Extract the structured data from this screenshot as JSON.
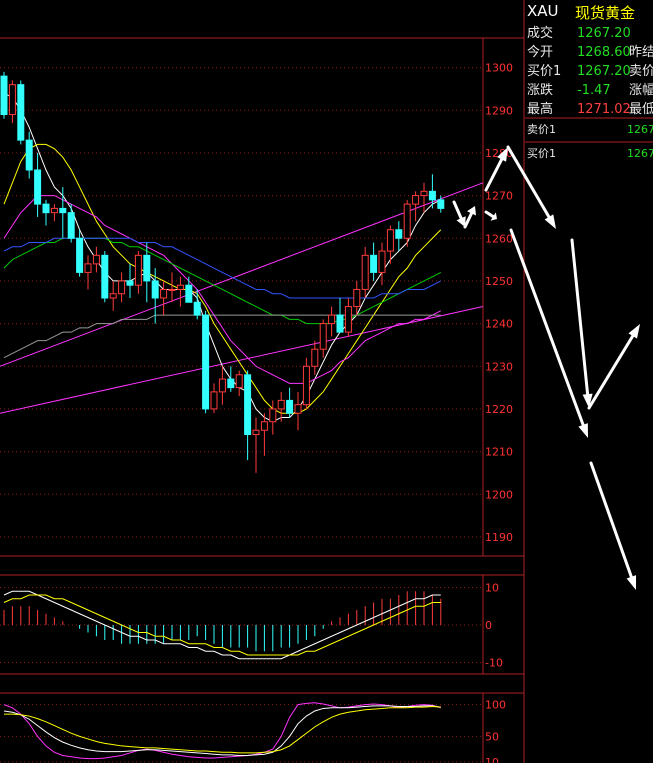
{
  "quote": {
    "symbol": "XAU",
    "name": "现货黄金",
    "rows": [
      {
        "label": "成交",
        "value": "1267.20",
        "value_color": "green",
        "label2": ""
      },
      {
        "label": "今开",
        "value": "1268.60",
        "value_color": "green",
        "label2": "昨结"
      },
      {
        "label": "买价1",
        "value": "1267.20",
        "value_color": "green",
        "label2": "卖价"
      },
      {
        "label": "涨跌",
        "value": "-1.47",
        "value_color": "green",
        "label2": "涨幅"
      },
      {
        "label": "最高",
        "value": "1271.02",
        "value_color": "red",
        "label2": "最低"
      }
    ],
    "orderbook": [
      {
        "label": "卖价1",
        "value": "1267"
      },
      {
        "label": "买价1",
        "value": "1267"
      }
    ]
  },
  "colors": {
    "up": "#ff3b3b",
    "down": "#33ffff",
    "frame": "#b02020",
    "ma5": "#ffffff",
    "ma10": "#ffff00",
    "ma20": "#ff33ff",
    "ma30": "#00cc00",
    "ma60": "#3355ff",
    "ma120": "#999999"
  },
  "chart_data": [
    {
      "type": "candlestick",
      "title": "",
      "ylim": [
        1186,
        1306
      ],
      "yticks": [
        1300,
        1290,
        1280,
        1270,
        1260,
        1250,
        1240,
        1230,
        1220,
        1210,
        1200,
        1190
      ],
      "ohlc": [
        [
          1298,
          1299,
          1288,
          1289
        ],
        [
          1289,
          1297,
          1287,
          1296
        ],
        [
          1296,
          1297,
          1282,
          1283
        ],
        [
          1283,
          1285,
          1274,
          1276
        ],
        [
          1276,
          1280,
          1265,
          1268
        ],
        [
          1268,
          1269,
          1263,
          1266
        ],
        [
          1266,
          1268,
          1264,
          1267
        ],
        [
          1267,
          1272,
          1260,
          1266
        ],
        [
          1266,
          1268,
          1259,
          1260
        ],
        [
          1260,
          1262,
          1251,
          1252
        ],
        [
          1252,
          1256,
          1248,
          1254
        ],
        [
          1254,
          1258,
          1252,
          1256
        ],
        [
          1256,
          1257,
          1245,
          1246
        ],
        [
          1246,
          1250,
          1243,
          1247
        ],
        [
          1247,
          1252,
          1245,
          1250
        ],
        [
          1250,
          1254,
          1246,
          1249
        ],
        [
          1249,
          1257,
          1247,
          1256
        ],
        [
          1256,
          1259,
          1245,
          1250
        ],
        [
          1250,
          1253,
          1240,
          1246
        ],
        [
          1246,
          1250,
          1242,
          1248
        ],
        [
          1248,
          1252,
          1245,
          1248
        ],
        [
          1248,
          1251,
          1244,
          1249
        ],
        [
          1249,
          1251,
          1246,
          1245
        ],
        [
          1245,
          1248,
          1241,
          1242
        ],
        [
          1242,
          1243,
          1219,
          1220
        ],
        [
          1220,
          1226,
          1219,
          1224
        ],
        [
          1224,
          1230,
          1221,
          1227
        ],
        [
          1227,
          1230,
          1224,
          1225
        ],
        [
          1225,
          1229,
          1223,
          1228
        ],
        [
          1228,
          1229,
          1208,
          1214
        ],
        [
          1214,
          1218,
          1205,
          1215
        ],
        [
          1215,
          1219,
          1209,
          1217
        ],
        [
          1217,
          1222,
          1214,
          1220
        ],
        [
          1220,
          1224,
          1217,
          1222
        ],
        [
          1222,
          1225,
          1218,
          1219
        ],
        [
          1219,
          1224,
          1215,
          1221
        ],
        [
          1221,
          1232,
          1220,
          1230
        ],
        [
          1230,
          1236,
          1228,
          1234
        ],
        [
          1234,
          1241,
          1232,
          1240
        ],
        [
          1240,
          1244,
          1237,
          1242
        ],
        [
          1242,
          1246,
          1239,
          1238
        ],
        [
          1238,
          1246,
          1237,
          1244
        ],
        [
          1244,
          1250,
          1242,
          1248
        ],
        [
          1248,
          1258,
          1246,
          1256
        ],
        [
          1256,
          1259,
          1250,
          1252
        ],
        [
          1252,
          1259,
          1249,
          1257
        ],
        [
          1257,
          1263,
          1254,
          1262
        ],
        [
          1262,
          1264,
          1257,
          1260
        ],
        [
          1260,
          1269,
          1258,
          1268
        ],
        [
          1268,
          1271,
          1264,
          1270
        ],
        [
          1270,
          1273,
          1266,
          1271
        ],
        [
          1271,
          1275,
          1267,
          1269
        ],
        [
          1269,
          1270,
          1266,
          1267
        ]
      ],
      "moving_averages": [
        {
          "color": "#ffffff",
          "values": [
            1294,
            1293,
            1290,
            1286,
            1281,
            1276,
            1272,
            1270,
            1267,
            1262,
            1258,
            1255,
            1252,
            1250,
            1250,
            1250,
            1251,
            1252,
            1250,
            1248,
            1248,
            1248,
            1248,
            1246,
            1240,
            1235,
            1230,
            1227,
            1225,
            1224,
            1220,
            1218,
            1217,
            1218,
            1218,
            1220,
            1223,
            1227,
            1231,
            1235,
            1238,
            1240,
            1242,
            1246,
            1249,
            1252,
            1255,
            1257,
            1259,
            1263,
            1266,
            1268,
            1269
          ]
        },
        {
          "color": "#ffff00",
          "values": [
            1268,
            1273,
            1278,
            1281,
            1282,
            1282,
            1281,
            1279,
            1276,
            1272,
            1268,
            1264,
            1261,
            1258,
            1256,
            1254,
            1253,
            1252,
            1251,
            1250,
            1249,
            1248,
            1248,
            1247,
            1244,
            1240,
            1237,
            1234,
            1231,
            1228,
            1225,
            1222,
            1220,
            1219,
            1219,
            1219,
            1220,
            1222,
            1224,
            1227,
            1230,
            1233,
            1236,
            1239,
            1242,
            1245,
            1248,
            1251,
            1253,
            1256,
            1258,
            1260,
            1262
          ]
        },
        {
          "color": "#ff33ff",
          "values": [
            1260,
            1263,
            1266,
            1268,
            1270,
            1270,
            1270,
            1269,
            1268,
            1267,
            1266,
            1265,
            1263,
            1262,
            1261,
            1260,
            1259,
            1258,
            1257,
            1256,
            1254,
            1252,
            1250,
            1248,
            1245,
            1242,
            1239,
            1236,
            1234,
            1232,
            1230,
            1229,
            1228,
            1227,
            1226,
            1226,
            1226,
            1227,
            1228,
            1229,
            1231,
            1232,
            1234,
            1236,
            1237,
            1238,
            1239,
            1240,
            1240,
            1241,
            1241,
            1242,
            1243
          ]
        },
        {
          "color": "#00cc00",
          "values": [
            1253,
            1255,
            1256,
            1257,
            1258,
            1259,
            1259,
            1260,
            1260,
            1260,
            1260,
            1260,
            1260,
            1259,
            1259,
            1258,
            1258,
            1257,
            1256,
            1255,
            1254,
            1253,
            1252,
            1251,
            1250,
            1249,
            1248,
            1247,
            1246,
            1245,
            1244,
            1243,
            1242,
            1242,
            1241,
            1241,
            1240,
            1240,
            1240,
            1240,
            1241,
            1241,
            1242,
            1243,
            1244,
            1245,
            1246,
            1247,
            1248,
            1249,
            1250,
            1251,
            1252
          ]
        },
        {
          "color": "#3355ff",
          "values": [
            1257,
            1258,
            1258,
            1259,
            1259,
            1259,
            1260,
            1260,
            1260,
            1260,
            1260,
            1260,
            1260,
            1260,
            1260,
            1260,
            1259,
            1259,
            1259,
            1258,
            1258,
            1257,
            1256,
            1255,
            1254,
            1253,
            1252,
            1251,
            1250,
            1249,
            1248,
            1248,
            1247,
            1247,
            1246,
            1246,
            1246,
            1246,
            1246,
            1246,
            1246,
            1246,
            1246,
            1246,
            1246,
            1247,
            1247,
            1247,
            1248,
            1248,
            1248,
            1249,
            1250
          ]
        },
        {
          "color": "#999999",
          "values": [
            1232,
            1233,
            1234,
            1235,
            1236,
            1236,
            1237,
            1238,
            1238,
            1239,
            1239,
            1240,
            1240,
            1240,
            1241,
            1241,
            1241,
            1241,
            1242,
            1242,
            1242,
            1242,
            1242,
            1242,
            1242,
            1242,
            1242,
            1242,
            1242,
            1242,
            1242,
            1242,
            1242,
            1242,
            1242,
            1242,
            1242,
            1242,
            1242,
            1242,
            1242,
            1242,
            1242,
            1242,
            1242,
            1242,
            1242,
            1242,
            1242,
            1242,
            1242,
            1242,
            1242
          ]
        }
      ]
    },
    {
      "type": "bar",
      "title": "",
      "ylim": [
        -12,
        12
      ],
      "yticks": [
        10,
        0,
        -10
      ],
      "values": [
        4,
        5,
        5,
        5,
        4,
        3,
        2,
        1,
        0,
        -1,
        -2,
        -3,
        -4,
        -4,
        -5,
        -5,
        -5,
        -5,
        -5,
        -5,
        -4,
        -4,
        -4,
        -3,
        -4,
        -5,
        -6,
        -6,
        -6,
        -6,
        -7,
        -7,
        -7,
        -6,
        -6,
        -5,
        -4,
        -3,
        -1,
        1,
        2,
        3,
        4,
        5,
        6,
        7,
        7,
        8,
        9,
        9,
        9,
        8,
        7
      ],
      "series": [
        {
          "color": "#ffffff",
          "values": [
            8,
            9,
            9,
            9,
            8,
            7,
            6,
            5,
            4,
            3,
            2,
            1,
            0,
            -1,
            -2,
            -3,
            -3,
            -4,
            -4,
            -5,
            -5,
            -5,
            -6,
            -6,
            -7,
            -7,
            -8,
            -8,
            -9,
            -9,
            -9,
            -9,
            -9,
            -9,
            -8,
            -7,
            -6,
            -5,
            -4,
            -3,
            -2,
            -1,
            0,
            1,
            2,
            3,
            4,
            5,
            6,
            7,
            7,
            8,
            8
          ]
        },
        {
          "color": "#ffff00",
          "values": [
            6,
            7,
            7,
            8,
            8,
            8,
            7,
            7,
            6,
            5,
            4,
            3,
            2,
            1,
            0,
            -1,
            -2,
            -2,
            -3,
            -3,
            -4,
            -4,
            -5,
            -5,
            -5,
            -6,
            -6,
            -7,
            -7,
            -8,
            -8,
            -8,
            -8,
            -8,
            -8,
            -8,
            -7,
            -7,
            -6,
            -5,
            -4,
            -3,
            -2,
            -1,
            0,
            1,
            2,
            3,
            4,
            5,
            5,
            6,
            6
          ]
        }
      ]
    },
    {
      "type": "line",
      "title": "",
      "ylim": [
        5,
        112
      ],
      "yticks": [
        100,
        50,
        10
      ],
      "series": [
        {
          "color": "#ff33ff",
          "values": [
            100,
            95,
            85,
            70,
            50,
            35,
            25,
            20,
            18,
            16,
            15,
            15,
            16,
            18,
            20,
            24,
            28,
            30,
            28,
            25,
            22,
            20,
            18,
            17,
            16,
            16,
            17,
            18,
            19,
            20,
            22,
            25,
            30,
            50,
            80,
            100,
            102,
            103,
            101,
            98,
            95,
            96,
            98,
            100,
            101,
            100,
            98,
            95,
            97,
            99,
            100,
            99,
            95
          ]
        },
        {
          "color": "#ffffff",
          "values": [
            90,
            88,
            84,
            77,
            67,
            57,
            48,
            41,
            36,
            32,
            29,
            27,
            26,
            26,
            26,
            27,
            28,
            29,
            29,
            28,
            27,
            26,
            25,
            24,
            23,
            22,
            21,
            21,
            20,
            20,
            21,
            22,
            25,
            35,
            50,
            70,
            82,
            90,
            94,
            95,
            95,
            95,
            96,
            97,
            98,
            98,
            98,
            97,
            97,
            97,
            98,
            98,
            96
          ]
        },
        {
          "color": "#ffff00",
          "values": [
            85,
            85,
            84,
            82,
            78,
            73,
            67,
            61,
            55,
            50,
            46,
            42,
            39,
            37,
            35,
            34,
            33,
            32,
            32,
            31,
            30,
            29,
            28,
            27,
            27,
            26,
            25,
            25,
            24,
            24,
            24,
            25,
            26,
            29,
            35,
            45,
            55,
            65,
            73,
            80,
            85,
            88,
            90,
            92,
            93,
            94,
            95,
            95,
            95,
            96,
            96,
            97,
            96
          ]
        }
      ]
    }
  ],
  "annotations": {
    "arrows": [
      [
        486,
        190,
        508,
        147
      ],
      [
        508,
        147,
        556,
        229
      ],
      [
        511,
        230,
        588,
        438
      ],
      [
        572,
        240,
        589,
        408
      ],
      [
        589,
        408,
        640,
        324
      ],
      [
        591,
        463,
        636,
        590
      ],
      [
        454,
        202,
        465,
        227
      ],
      [
        465,
        227,
        475,
        206
      ],
      [
        486,
        212,
        497,
        219
      ]
    ]
  }
}
